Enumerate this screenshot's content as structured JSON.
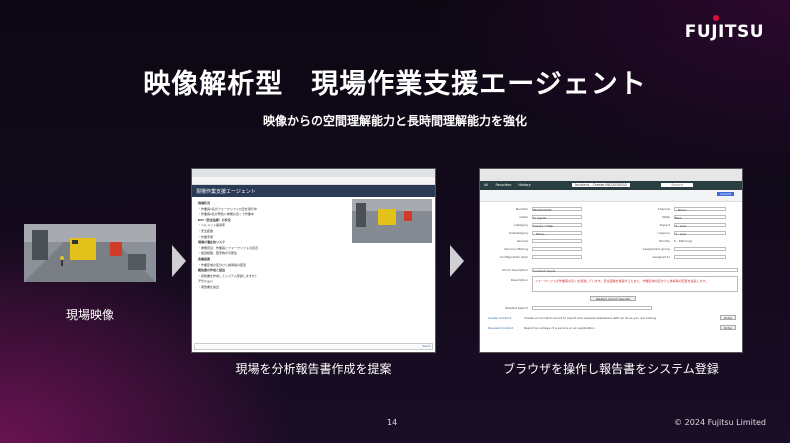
{
  "brand": {
    "logo_text": "FUJITSU"
  },
  "slide": {
    "title": "映像解析型　現場作業支援エージェント",
    "subtitle": "映像からの空間理解能力と長時間理解能力を強化",
    "page_number": "14",
    "copyright": "© 2024 Fujitsu Limited"
  },
  "steps": [
    {
      "caption": "現場映像"
    },
    {
      "caption": "現場を分析報告書作成を提案"
    },
    {
      "caption": "ブラウザを操作し報告書をシステム登録"
    }
  ],
  "report_app": {
    "header_title": "現場作業支援エージェント",
    "lines": [
      "現場状況",
      "・作業員1名がフォークリフト付近を通行中",
      "・作業員2名が黄色い重機の近くで作業中",
      "KPI（安全指標）の状況",
      "・ヘルメット着用率",
      "・安全距離",
      "・作業手順",
      "現場の潜在的リスク",
      "・重機周辺：作業員とフォークリフトの接近",
      "・搬送経路：障害物の可能性",
      "改善提案",
      "・作業区域の区分けと誘導員の配置",
      "報告書の作成と提出",
      "・報告書を作成してシステム登録しますか？",
      "アクション",
      "・報告書を提出"
    ],
    "send_label": "Send"
  },
  "incident_app": {
    "nav": [
      "All",
      "Favorites",
      "History"
    ],
    "record_title": "Incident - Create INC0010002",
    "search_placeholder": "Search",
    "buttons": {
      "submit": "Submit",
      "related": "Related Search Results"
    },
    "fields_left": [
      {
        "label": "Number",
        "value": "INC0010002"
      },
      {
        "label": "Caller",
        "value": "AI Agent"
      },
      {
        "label": "Category",
        "value": "Inquiry / Help"
      },
      {
        "label": "Subcategory",
        "value": "-- None --"
      },
      {
        "label": "Service",
        "value": ""
      },
      {
        "label": "Service offering",
        "value": ""
      },
      {
        "label": "Configuration item",
        "value": ""
      }
    ],
    "fields_right": [
      {
        "label": "Channel",
        "value": "-- None --"
      },
      {
        "label": "State",
        "value": "New"
      },
      {
        "label": "Impact",
        "value": "3 - Low"
      },
      {
        "label": "Urgency",
        "value": "3 - Low"
      },
      {
        "label": "Priority",
        "value": "5 - Planning"
      },
      {
        "label": "Assignment group",
        "value": ""
      },
      {
        "label": "Assigned to",
        "value": ""
      }
    ],
    "short_description_label": "Short description",
    "short_description_value": "Incident report",
    "description_label": "Description",
    "description_value": "フォークリフトが作業員の近くを通過しています。安全距離を確保するために、作業区域の区分けと誘導員の配置を提案します。",
    "related_search_label": "Related Search",
    "related_links": [
      "Create Incident",
      "Request Incident"
    ],
    "related_texts": [
      "Create an Incident record to report and request assistance with an issue you are having",
      "Report an outage of a service or an application"
    ],
    "order_label": "Order"
  }
}
